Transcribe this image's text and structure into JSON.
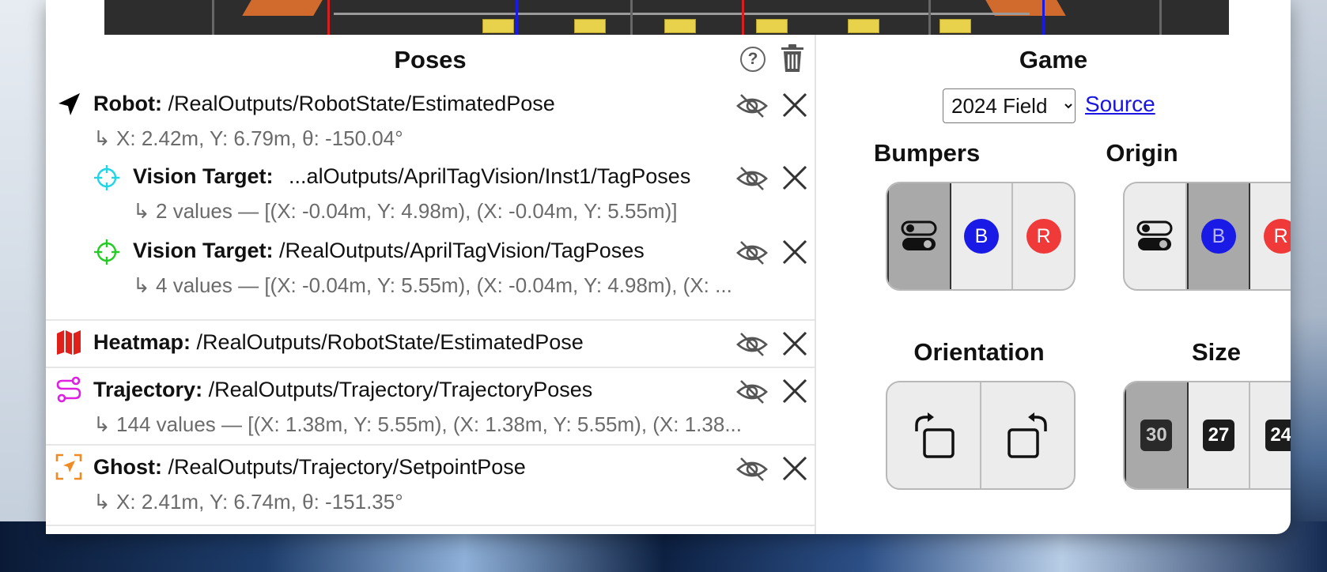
{
  "poses": {
    "title": "Poses",
    "help_label": "?",
    "items": [
      {
        "kind": "Robot:",
        "path": "/RealOutputs/RobotState/EstimatedPose",
        "detail": "X: 2.42m, Y: 6.79m, θ: -150.04°",
        "icon": "navigation-arrow-icon",
        "color": "#000000"
      },
      {
        "kind": "Vision Target:",
        "path": "...alOutputs/AprilTagVision/Inst1/TagPoses",
        "detail": "2 values — [(X: -0.04m, Y: 4.98m), (X: -0.04m, Y: 5.55m)]",
        "icon": "crosshair-icon",
        "color": "#1fd6e6"
      },
      {
        "kind": "Vision Target:",
        "path": "/RealOutputs/AprilTagVision/TagPoses",
        "detail": "4 values — [(X: -0.04m, Y: 5.55m), (X: -0.04m, Y: 4.98m), (X: ...",
        "icon": "crosshair-icon",
        "color": "#22cc22"
      },
      {
        "kind": "Heatmap:",
        "path": "/RealOutputs/RobotState/EstimatedPose",
        "detail": "",
        "icon": "map-icon",
        "color": "#e0201a"
      },
      {
        "kind": "Trajectory:",
        "path": "/RealOutputs/Trajectory/TrajectoryPoses",
        "detail": "144 values — [(X: 1.38m, Y: 5.55m), (X: 1.38m, Y: 5.55m), (X: 1.38...",
        "icon": "route-icon",
        "color": "#e020e0"
      },
      {
        "kind": "Ghost:",
        "path": "/RealOutputs/Trajectory/SetpointPose",
        "detail": "X: 2.41m, Y: 6.74m, θ: -151.35°",
        "icon": "ghost-target-icon",
        "color": "#f08a24"
      }
    ],
    "detail_prefix": "↳"
  },
  "game": {
    "title": "Game",
    "field_selected": "2024 Field",
    "field_options": [
      "2024 Field"
    ],
    "source_label": "Source",
    "bumpers": {
      "title": "Bumpers",
      "options": [
        "toggle",
        "B",
        "R"
      ],
      "selected": "toggle"
    },
    "origin": {
      "title": "Origin",
      "options": [
        "toggle",
        "B",
        "R"
      ],
      "selected": "B"
    },
    "orientation": {
      "title": "Orientation",
      "options": [
        "rotate-left",
        "rotate-right"
      ]
    },
    "size": {
      "title": "Size",
      "options": [
        "30",
        "27",
        "24"
      ],
      "selected": "30"
    },
    "colors": {
      "blue": "#1a1ae6",
      "red": "#f03a3a",
      "selected_bg": "#a9a9a9"
    }
  }
}
